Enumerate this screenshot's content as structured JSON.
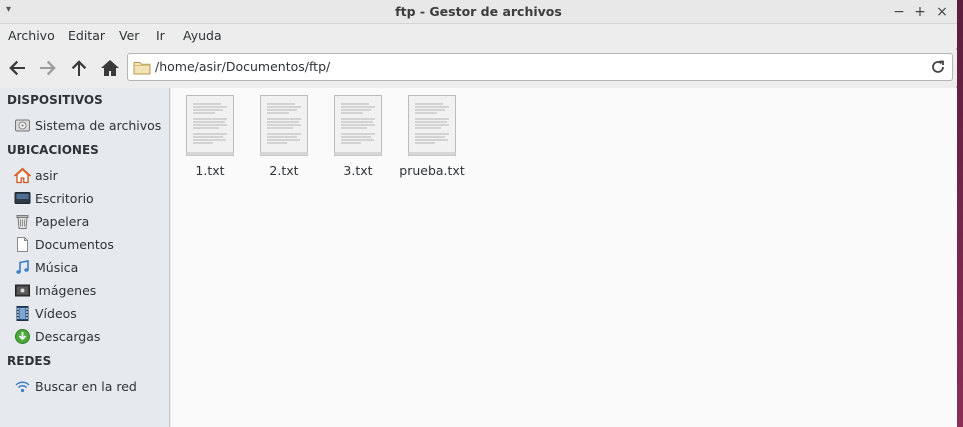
{
  "window": {
    "title": "ftp - Gestor de archivos",
    "menu_arrow_icon": "window-menu-icon",
    "controls": [
      "minimize",
      "maximize",
      "close"
    ],
    "minimize_glyph": "−",
    "maximize_glyph": "+",
    "close_glyph": "×"
  },
  "menubar": {
    "items": [
      {
        "label": "Archivo"
      },
      {
        "label": "Editar"
      },
      {
        "label": "Ver"
      },
      {
        "label": "Ir"
      },
      {
        "label": "Ayuda"
      }
    ]
  },
  "toolbar": {
    "address": "/home/asir/Documentos/ftp/"
  },
  "sidebar": {
    "sections": [
      {
        "title": "DISPOSITIVOS",
        "items": [
          {
            "label": "Sistema de archivos",
            "icon": "drive-icon"
          }
        ]
      },
      {
        "title": "UBICACIONES",
        "items": [
          {
            "label": "asir",
            "icon": "home-icon"
          },
          {
            "label": "Escritorio",
            "icon": "desktop-icon"
          },
          {
            "label": "Papelera",
            "icon": "trash-icon"
          },
          {
            "label": "Documentos",
            "icon": "document-icon"
          },
          {
            "label": "Música",
            "icon": "music-icon"
          },
          {
            "label": "Imágenes",
            "icon": "pictures-icon"
          },
          {
            "label": "Vídeos",
            "icon": "video-icon"
          },
          {
            "label": "Descargas",
            "icon": "download-icon"
          }
        ]
      },
      {
        "title": "REDES",
        "items": [
          {
            "label": "Buscar en la red",
            "icon": "network-icon"
          }
        ]
      }
    ]
  },
  "files": [
    {
      "name": "1.txt",
      "icon": "text-file-icon"
    },
    {
      "name": "2.txt",
      "icon": "text-file-icon"
    },
    {
      "name": "3.txt",
      "icon": "text-file-icon"
    },
    {
      "name": "prueba.txt",
      "icon": "text-file-icon"
    }
  ],
  "colors": {
    "accent_blue": "#3d7dca",
    "home_orange": "#e06a2b",
    "download_green": "#4aa93a",
    "sidebar_bg": "#e6e9ed",
    "content_bg": "#fafafa"
  }
}
